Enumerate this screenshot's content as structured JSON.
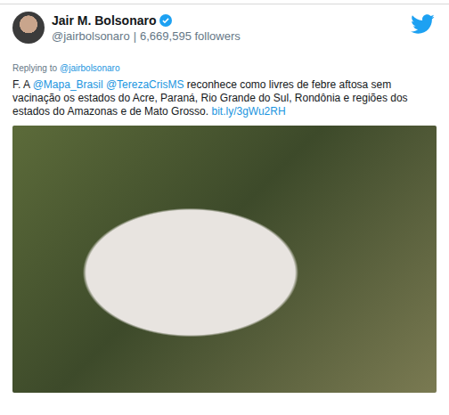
{
  "author": {
    "name": "Jair M. Bolsonaro",
    "verified": true,
    "handle": "@jairbolsonaro",
    "separator": "|",
    "followers": "6,669,595 followers"
  },
  "reply": {
    "prefix": "Replying to",
    "to": "@jairbolsonaro"
  },
  "tweet": {
    "segments": [
      {
        "text": "F. A ",
        "kind": "plain"
      },
      {
        "text": "@Mapa_Brasil",
        "kind": "mention"
      },
      {
        "text": " ",
        "kind": "plain"
      },
      {
        "text": "@TerezaCrisMS",
        "kind": "mention"
      },
      {
        "text": " reconhece como livres de febre aftosa sem vacinação os estados do Acre, Paraná, Rio Grande do Sul, Rondônia e regiões dos estados do Amazonas e de Mato Grosso. ",
        "kind": "plain"
      },
      {
        "text": "bit.ly/3gWu2RH",
        "kind": "link"
      }
    ]
  }
}
